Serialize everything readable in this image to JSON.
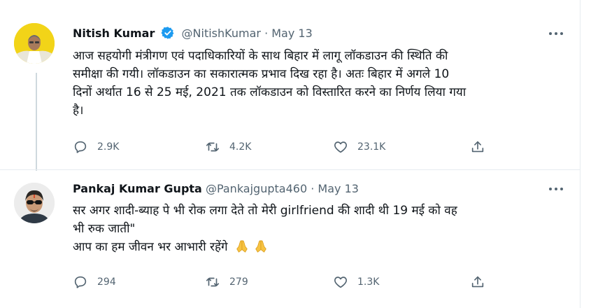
{
  "tweets": [
    {
      "author_name": "Nitish Kumar",
      "verified": true,
      "handle": "@NitishKumar",
      "separator": "·",
      "date": "May 13",
      "text_lines": [
        "आज सहयोगी मंत्रीगण एवं पदाधिकारियों के साथ बिहार में लागू लॉकडाउन की स्थिति की",
        "समीक्षा की गयी। लॉकडाउन का सकारात्मक प्रभाव दिख रहा है। अतः बिहार में अगले 10",
        "दिनों अर्थात 16 से 25 मई, 2021 तक लॉकडाउन को विस्तारित करने का निर्णय लिया गया",
        "है।"
      ],
      "stats": {
        "replies": "2.9K",
        "retweets": "4.2K",
        "likes": "23.1K"
      }
    },
    {
      "author_name": "Pankaj Kumar Gupta",
      "verified": false,
      "handle": "@Pankajgupta460",
      "separator": "·",
      "date": "May 13",
      "text_lines": [
        "सर अगर शादी-ब्याह पे भी रोक लगा देते तो मेरी girlfriend की शादी थी 19 मई को वह",
        "भी रुक जाती\"",
        "आप का हम जीवन भर आभारी रहेंगे"
      ],
      "emoji": "folded-hands-x2",
      "stats": {
        "replies": "294",
        "retweets": "279",
        "likes": "1.3K"
      }
    }
  ],
  "colors": {
    "text": "#0f1419",
    "muted": "#536471",
    "verified": "#1d9bf0",
    "border": "#e6ecf0"
  }
}
